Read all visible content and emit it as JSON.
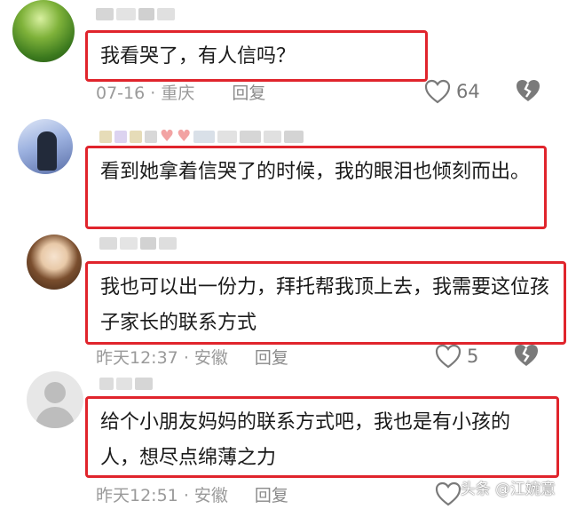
{
  "comments": [
    {
      "text": "我看哭了，有人信吗？",
      "date": "07-16",
      "location": "重庆",
      "reply_label": "回复",
      "likes": "64",
      "avatar_icon": "landscape-avatar"
    },
    {
      "text": "看到她拿着信哭了的时候，我的眼泪也倾刻而出。",
      "avatar_icon": "portrait-avatar"
    },
    {
      "text": "我也可以出一份力，拜托帮我顶上去，我需要这位孩子家长的联系方式",
      "date": "昨天12:37",
      "location": "安徽",
      "reply_label": "回复",
      "likes": "5",
      "avatar_icon": "girl-avatar"
    },
    {
      "text": "给个小朋友妈妈的联系方式吧，我也是有小孩的人，想尽点绵薄之力",
      "date": "昨天12:51",
      "location": "安徽",
      "reply_label": "回复",
      "avatar_icon": "default-avatar"
    }
  ],
  "separator": "·",
  "watermark": "头条 @江婉意",
  "colors": {
    "highlight_border": "#e0242c",
    "meta_text": "#9a9a9a"
  }
}
